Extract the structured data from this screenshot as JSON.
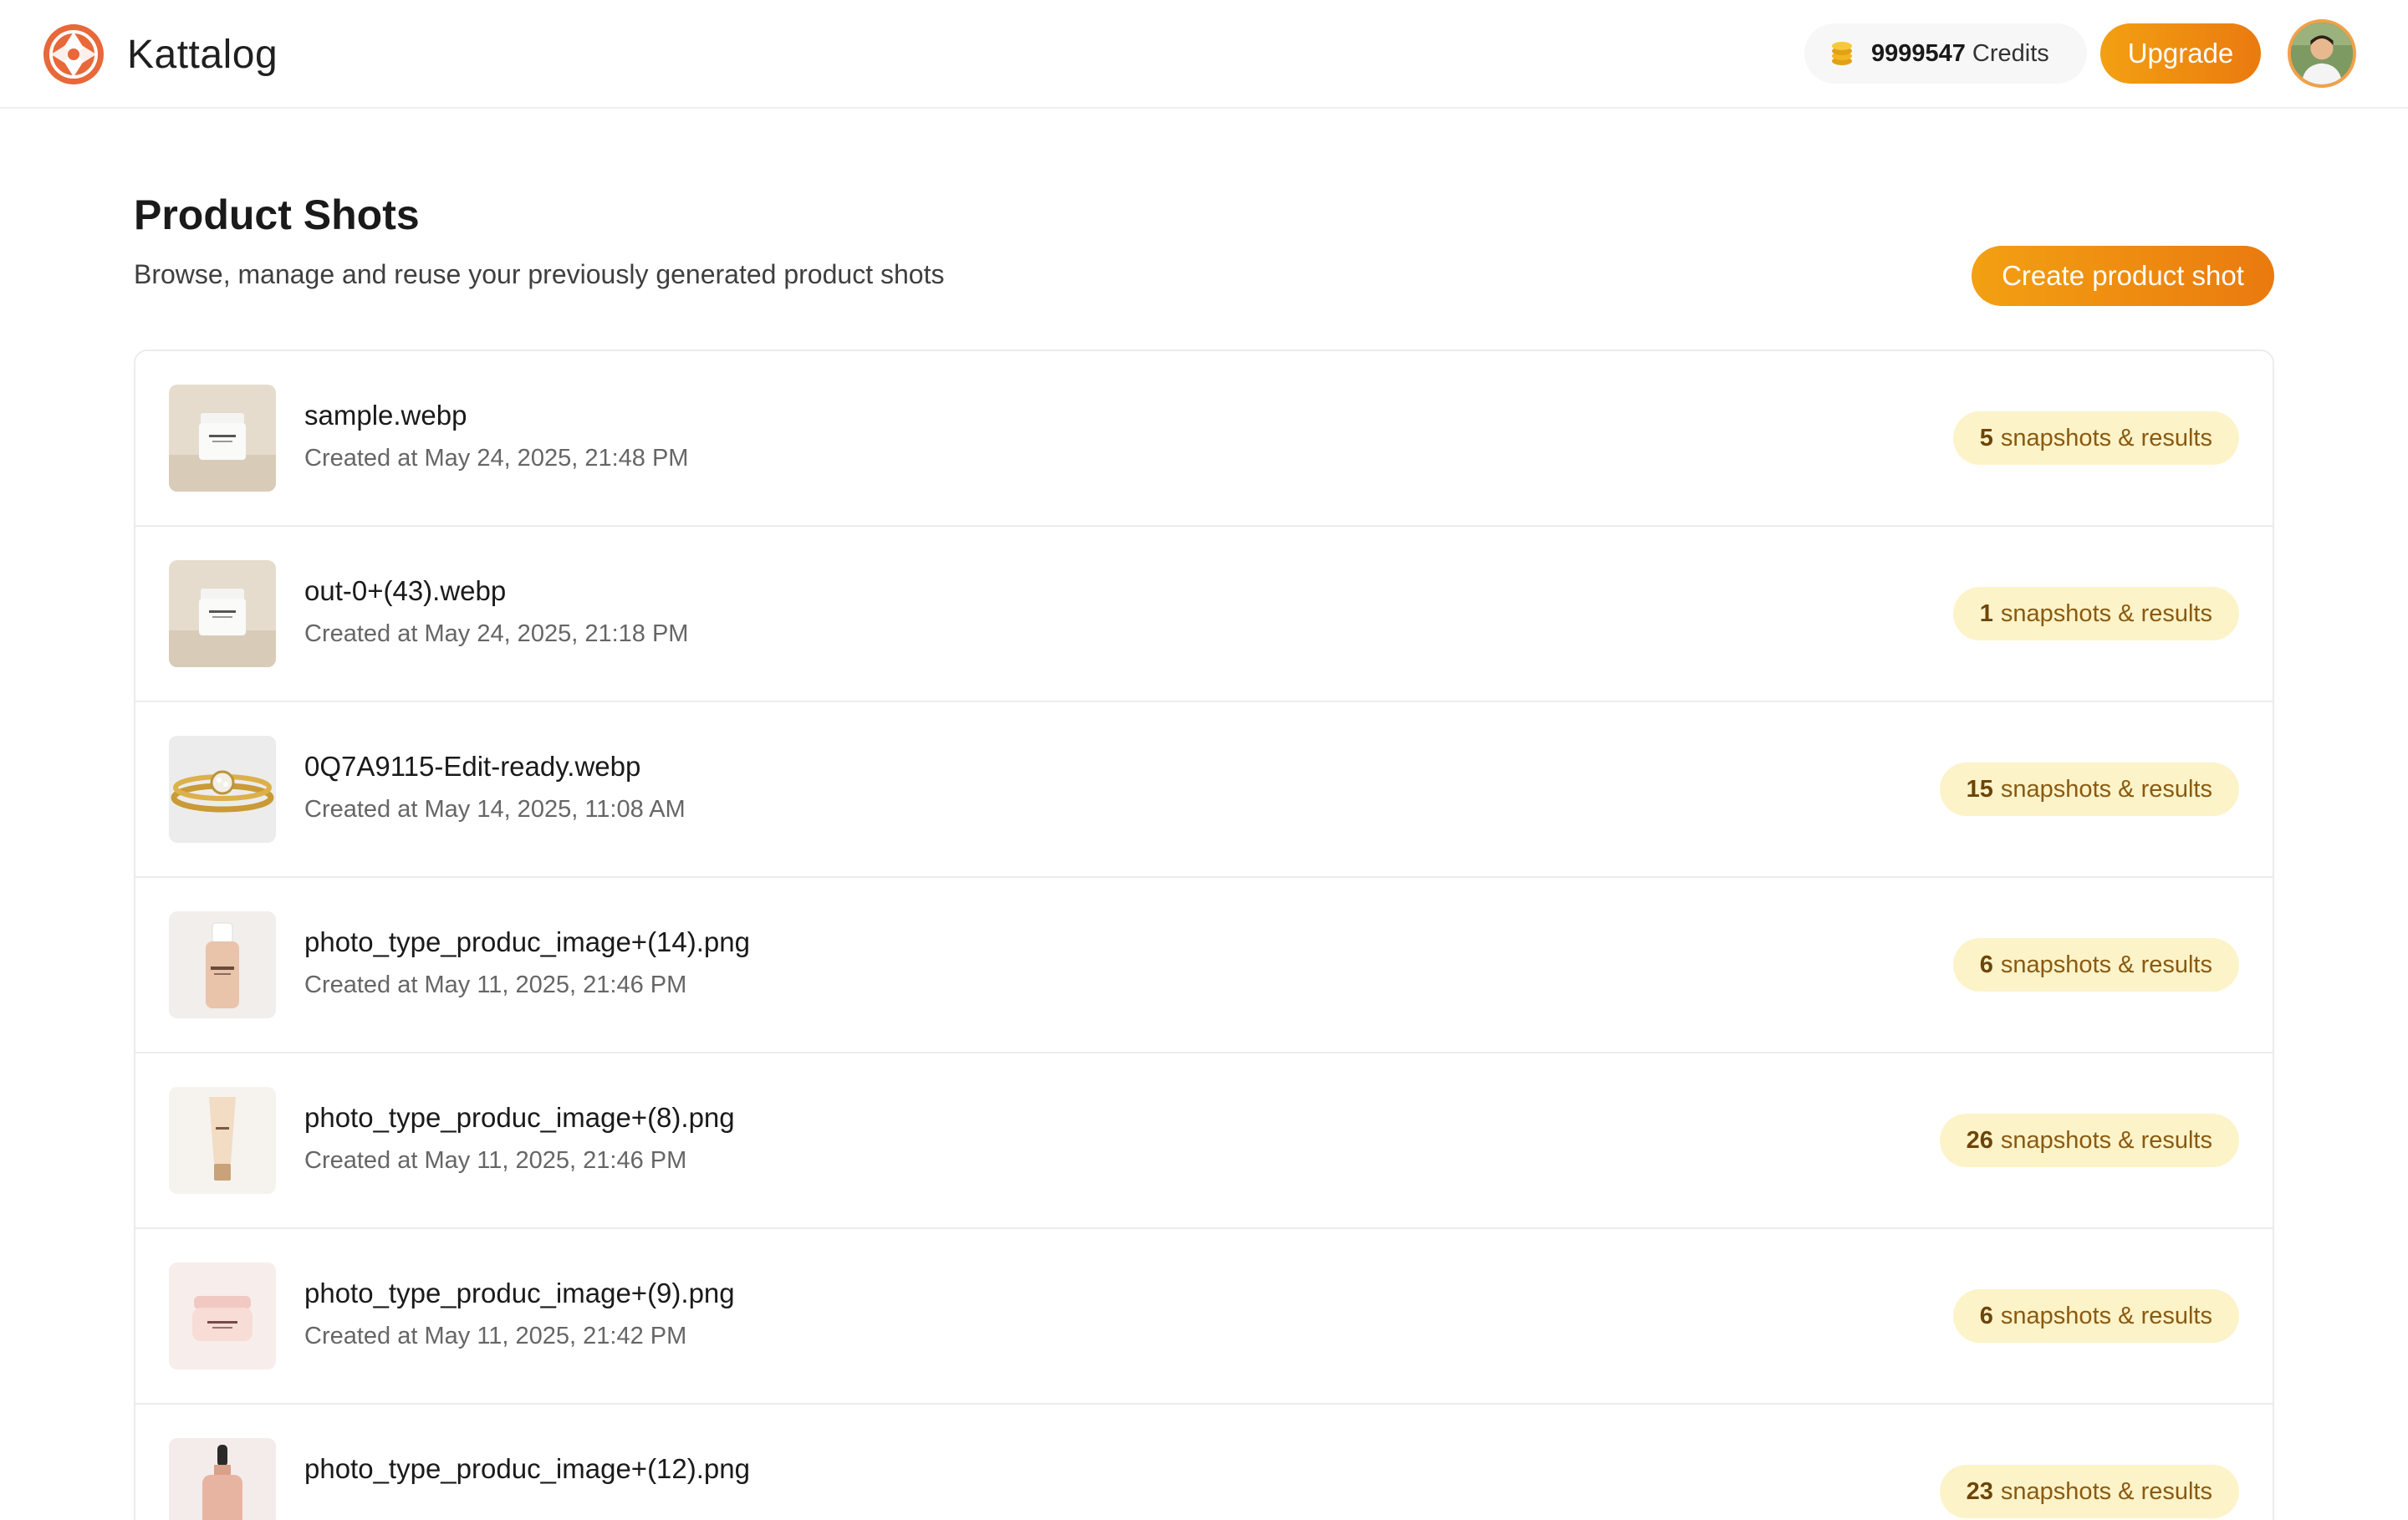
{
  "header": {
    "brand_name": "Kattalog",
    "credits_value": "9999547",
    "credits_label": "Credits",
    "upgrade_label": "Upgrade"
  },
  "page": {
    "title": "Product Shots",
    "subtitle": "Browse, manage and reuse your previously generated product shots",
    "create_label": "Create product shot"
  },
  "shots": [
    {
      "name": "sample.webp",
      "created": "Created at May 24, 2025, 21:48 PM",
      "count": "5",
      "count_label": "snapshots & results",
      "thumb": "cream-jar"
    },
    {
      "name": "out-0+(43).webp",
      "created": "Created at May 24, 2025, 21:18 PM",
      "count": "1",
      "count_label": "snapshots & results",
      "thumb": "cream-jar"
    },
    {
      "name": "0Q7A9115-Edit-ready.webp",
      "created": "Created at May 14, 2025, 11:08 AM",
      "count": "15",
      "count_label": "snapshots & results",
      "thumb": "gold-rings"
    },
    {
      "name": "photo_type_produc_image+(14).png",
      "created": "Created at May 11, 2025, 21:46 PM",
      "count": "6",
      "count_label": "snapshots & results",
      "thumb": "foundation-bottle"
    },
    {
      "name": "photo_type_produc_image+(8).png",
      "created": "Created at May 11, 2025, 21:46 PM",
      "count": "26",
      "count_label": "snapshots & results",
      "thumb": "cream-tube"
    },
    {
      "name": "photo_type_produc_image+(9).png",
      "created": "Created at May 11, 2025, 21:42 PM",
      "count": "6",
      "count_label": "snapshots & results",
      "thumb": "pink-jar"
    },
    {
      "name": "photo_type_produc_image+(12).png",
      "created": "",
      "count": "23",
      "count_label": "snapshots & results",
      "thumb": "dropper-bottle"
    }
  ],
  "icons": {
    "brand": "kattalog-logo-icon",
    "credits": "coin-stack-icon",
    "avatar": "user-avatar"
  },
  "colors": {
    "accent": "#ef8c10",
    "badge_bg": "#fdf3c9",
    "badge_text": "#8a5a10"
  }
}
